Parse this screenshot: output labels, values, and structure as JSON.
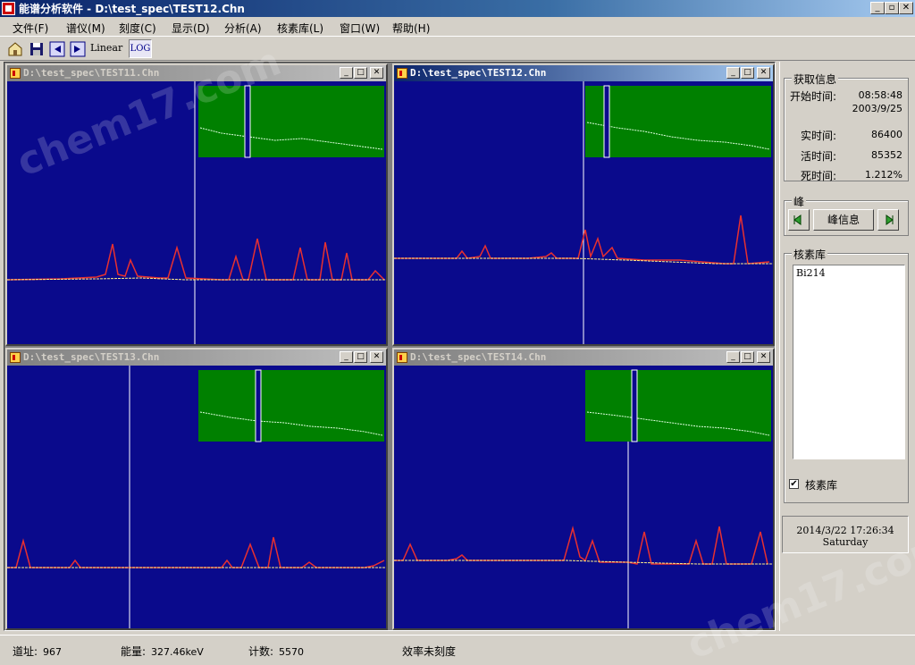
{
  "window": {
    "title": "能谱分析软件 - D:\\test_spec\\TEST12.Chn",
    "min": "_",
    "restore": "▫",
    "close": "✕"
  },
  "menu": [
    "文件(F)",
    "谱仪(M)",
    "刻度(C)",
    "显示(D)",
    "分析(A)",
    "核素库(L)",
    "窗口(W)",
    "帮助(H)"
  ],
  "toolbar": {
    "linear": "Linear",
    "log": "LOG",
    "icons": [
      "open-icon",
      "save-icon",
      "left-arrow-icon",
      "right-arrow-icon"
    ]
  },
  "children": [
    {
      "title": "D:\\test_spec\\TEST11.Chn",
      "active": false
    },
    {
      "title": "D:\\test_spec\\TEST12.Chn",
      "active": true
    },
    {
      "title": "D:\\test_spec\\TEST13.Chn",
      "active": false
    },
    {
      "title": "D:\\test_spec\\TEST14.Chn",
      "active": false
    }
  ],
  "info": {
    "group": "获取信息",
    "start_label": "开始时间:",
    "start_time": "08:58:48",
    "start_date": "2003/9/25",
    "real_label": "实时间:",
    "real_value": "86400",
    "live_label": "活时间:",
    "live_value": "85352",
    "dead_label": "死时间:",
    "dead_value": "1.212%"
  },
  "peak": {
    "group": "峰",
    "info_button": "峰信息"
  },
  "library": {
    "group": "核素库",
    "items": [
      "Bi214"
    ],
    "checkbox_label": "核素库",
    "checked": true
  },
  "datetime": {
    "line1": "2014/3/22 17:26:34",
    "line2": "Saturday"
  },
  "status": {
    "channel_label": "道址:",
    "channel_value": "967",
    "energy_label": "能量:",
    "energy_value": "327.46keV",
    "count_label": "计数:",
    "count_value": "5570",
    "efficiency": "效率未刻度"
  },
  "watermark": "chem17.com",
  "colors": {
    "plot_bg": "#0a0a8c",
    "overview_bg": "#008000",
    "peak_color": "#e83030",
    "baseline": "#ffee88"
  }
}
